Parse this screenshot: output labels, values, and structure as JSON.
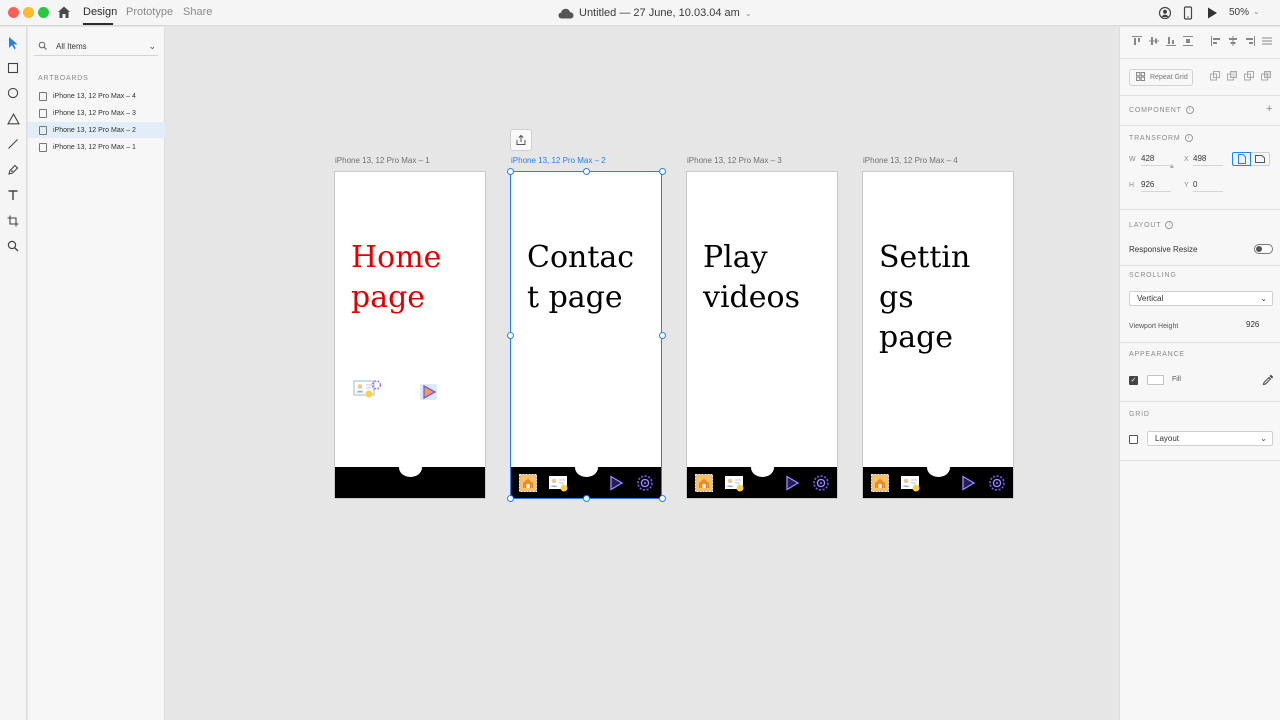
{
  "topbar": {
    "tabs": {
      "design": "Design",
      "prototype": "Prototype",
      "share": "Share"
    },
    "document_title": "Untitled — 27 June, 10.03.04 am",
    "zoom": "50%"
  },
  "layers": {
    "filter": "All Items",
    "heading": "ARTBOARDS",
    "items": [
      {
        "label": "iPhone 13, 12 Pro Max – 4"
      },
      {
        "label": "iPhone 13, 12 Pro Max – 3"
      },
      {
        "label": "iPhone 13, 12 Pro Max – 2",
        "selected": true
      },
      {
        "label": "iPhone 13, 12 Pro Max – 1"
      }
    ]
  },
  "canvas": {
    "artboards": [
      {
        "label": "iPhone 13, 12 Pro Max – 1",
        "text": "Home\npage",
        "text_color": "#e00000"
      },
      {
        "label": "iPhone 13, 12 Pro Max – 2",
        "text": "Contac\nt page",
        "text_color": "#000000",
        "selected": true
      },
      {
        "label": "iPhone 13, 12 Pro Max – 3",
        "text": "Play\nvideos",
        "text_color": "#000000"
      },
      {
        "label": "iPhone 13, 12 Pro Max – 4",
        "text": "Settin\ngs\npage",
        "text_color": "#000000"
      }
    ],
    "selection_color": "#2680eb"
  },
  "properties": {
    "repeat_grid": "Repeat Grid",
    "component_heading": "COMPONENT",
    "transform_heading": "TRANSFORM",
    "transform": {
      "w_label": "W",
      "w": "428",
      "x_label": "X",
      "x": "498",
      "h_label": "H",
      "h": "926",
      "y_label": "Y",
      "y": "0"
    },
    "layout_heading": "LAYOUT",
    "responsive_resize": "Responsive Resize",
    "scrolling_heading": "SCROLLING",
    "scrolling_value": "Vertical",
    "viewport_height_label": "Viewport Height",
    "viewport_height": "926",
    "appearance_heading": "APPEARANCE",
    "fill_label": "Fill",
    "grid_heading": "GRID",
    "grid_value": "Layout"
  }
}
